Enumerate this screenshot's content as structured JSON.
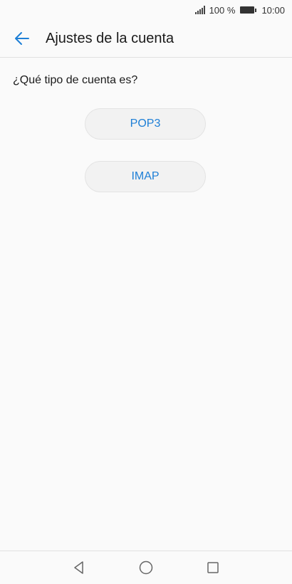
{
  "status_bar": {
    "battery_percent": "100 %",
    "time": "10:00"
  },
  "app_bar": {
    "title": "Ajustes de la cuenta"
  },
  "content": {
    "question": "¿Qué tipo de cuenta es?",
    "options": [
      {
        "label": "POP3"
      },
      {
        "label": "IMAP"
      }
    ]
  },
  "colors": {
    "accent": "#1e7fd6",
    "background": "#fafafa",
    "button_bg": "#f2f2f2"
  },
  "icons": {
    "back": "arrow-left-icon",
    "nav_back": "triangle-back-icon",
    "nav_home": "circle-home-icon",
    "nav_recent": "square-recent-icon"
  }
}
